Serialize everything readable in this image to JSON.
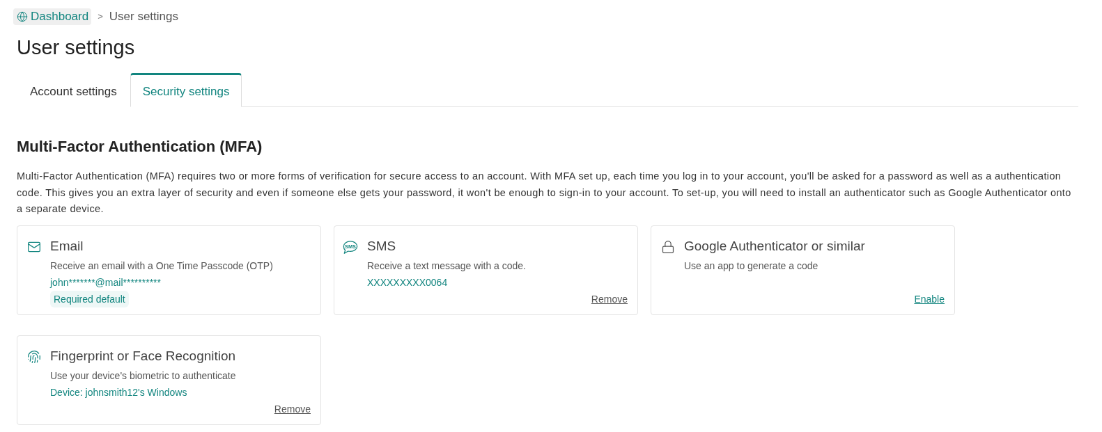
{
  "breadcrumb": {
    "items": [
      {
        "label": "Dashboard",
        "current": false
      },
      {
        "label": "User settings",
        "current": true
      }
    ],
    "separator": ">"
  },
  "page_title": "User settings",
  "tabs": [
    {
      "label": "Account settings",
      "selected": false
    },
    {
      "label": "Security settings",
      "selected": true
    }
  ],
  "mfa": {
    "heading": "Multi-Factor Authentication (MFA)",
    "description": "Multi-Factor Authentication (MFA) requires two or more forms of verification for secure access to an account. With MFA set up, each time you log in to your account, you'll be asked for a password as well as a authentication code. This gives you an extra layer of security and even if someone else gets your password, it won't be enough to sign-in to your account. To set-up, you will need to install an authenticator such as Google Authenticator onto a separate device.",
    "methods": [
      {
        "kind": "email",
        "title": "Email",
        "description": "Receive an email with a One Time Passcode (OTP)",
        "value": "john*******@mail**********",
        "badge": "Required default"
      },
      {
        "kind": "sms",
        "icon_text": "SMS",
        "title": "SMS",
        "description": "Receive a text message with a code.",
        "value": "XXXXXXXXX0064",
        "action": {
          "kind": "remove",
          "label": "Remove"
        }
      },
      {
        "kind": "authenticator",
        "title": "Google Authenticator or similar",
        "description": "Use an app to generate a code",
        "action": {
          "kind": "enable",
          "label": "Enable"
        }
      },
      {
        "kind": "biometric",
        "title": "Fingerprint or Face Recognition",
        "description": "Use your device's biometric to authenticate",
        "value": "Device: johnsmith12's Windows",
        "action": {
          "kind": "remove",
          "label": "Remove"
        }
      }
    ]
  }
}
